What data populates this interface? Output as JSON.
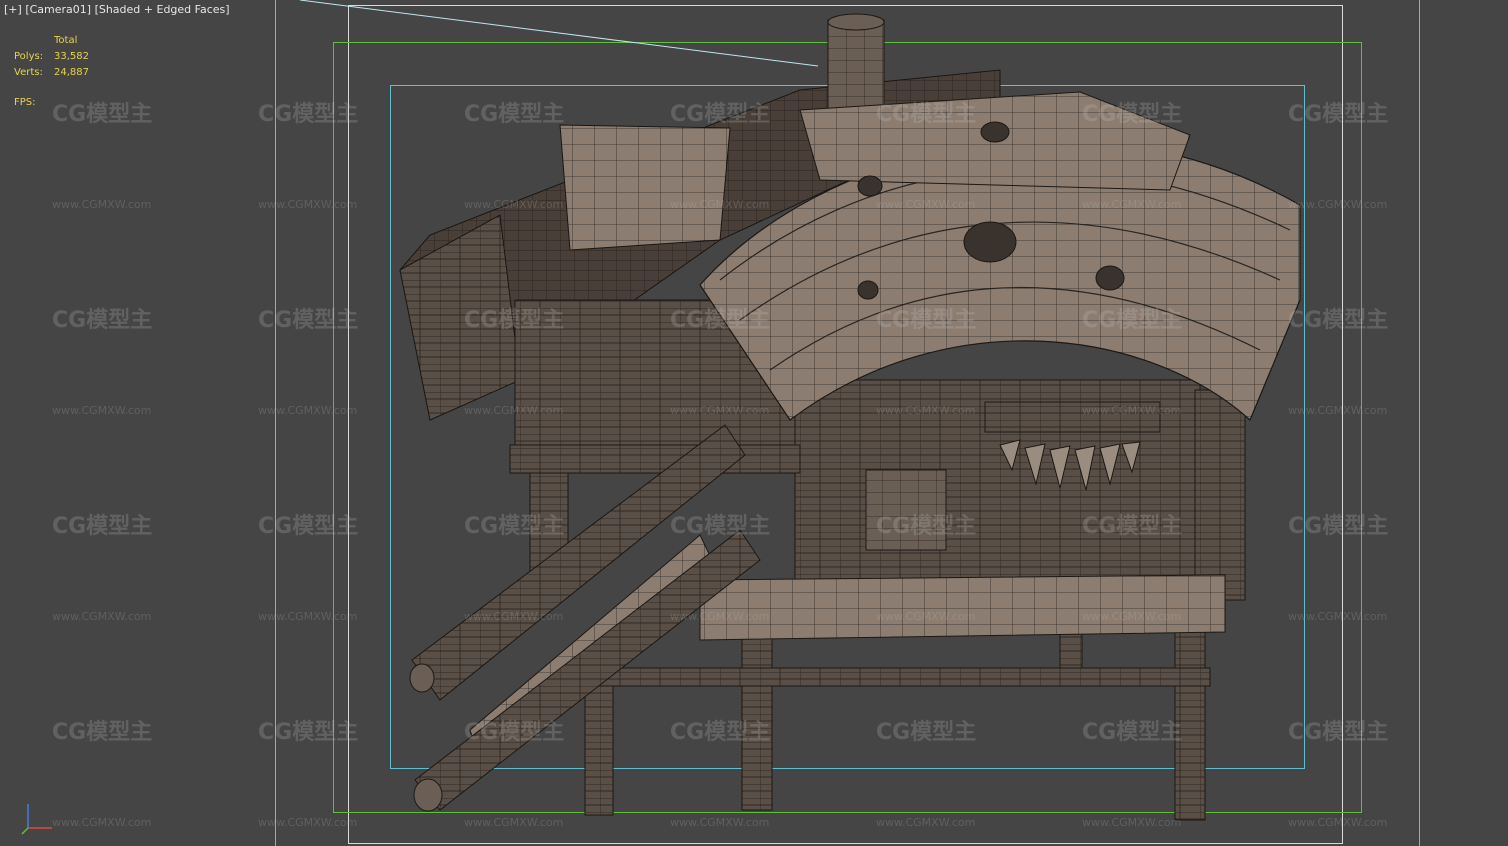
{
  "viewport": {
    "label_parts": [
      "[+]",
      "[Camera01]",
      "[Shaded + Edged Faces]"
    ]
  },
  "stats": {
    "header": "Total",
    "polys_label": "Polys:",
    "polys_value": "33,582",
    "verts_label": "Verts:",
    "verts_value": "24,887",
    "fps_label": "FPS:"
  },
  "watermark": {
    "logo_text": "CG模型主",
    "url_text": "www.CGMXW.com"
  },
  "colors": {
    "background": "#454545",
    "stats_text": "#e8d24a",
    "safe_frame_white": "#d9d9d9",
    "safe_frame_green": "#5fbf3a",
    "safe_frame_cyan": "#5fbfd0",
    "region_line": "#c9c23a"
  },
  "scene": {
    "description_icon": "wooden-stilt-hut-model"
  }
}
